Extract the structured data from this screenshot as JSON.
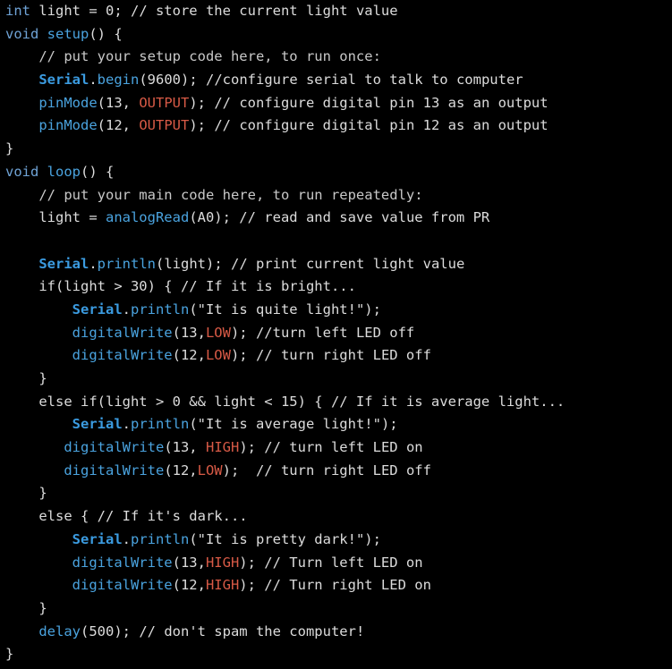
{
  "colors": {
    "background": "#000000",
    "plain": "#dcdcdc",
    "type_keyword": "#6fa3d6",
    "function": "#4aa3df",
    "serial_object": "#3b9be0",
    "constant": "#d85a46"
  },
  "code": {
    "lines": [
      [
        {
          "t": "int",
          "k": "type"
        },
        {
          "t": " light = 0; // store the current light value",
          "k": "plain"
        }
      ],
      [
        {
          "t": "void",
          "k": "type"
        },
        {
          "t": " ",
          "k": "plain"
        },
        {
          "t": "setup",
          "k": "func"
        },
        {
          "t": "() {",
          "k": "plain"
        }
      ],
      [
        {
          "t": "    // put your setup code here, to run once:",
          "k": "comment"
        }
      ],
      [
        {
          "t": "    ",
          "k": "plain"
        },
        {
          "t": "Serial",
          "k": "serial"
        },
        {
          "t": ".",
          "k": "plain"
        },
        {
          "t": "begin",
          "k": "func"
        },
        {
          "t": "(9600); //configure serial to talk to computer",
          "k": "plain"
        }
      ],
      [
        {
          "t": "    ",
          "k": "plain"
        },
        {
          "t": "pinMode",
          "k": "func"
        },
        {
          "t": "(13, ",
          "k": "plain"
        },
        {
          "t": "OUTPUT",
          "k": "const"
        },
        {
          "t": "); // configure digital pin 13 as an output",
          "k": "plain"
        }
      ],
      [
        {
          "t": "    ",
          "k": "plain"
        },
        {
          "t": "pinMode",
          "k": "func"
        },
        {
          "t": "(12, ",
          "k": "plain"
        },
        {
          "t": "OUTPUT",
          "k": "const"
        },
        {
          "t": "); // configure digital pin 12 as an output",
          "k": "plain"
        }
      ],
      [
        {
          "t": "}",
          "k": "plain"
        }
      ],
      [
        {
          "t": "void",
          "k": "type"
        },
        {
          "t": " ",
          "k": "plain"
        },
        {
          "t": "loop",
          "k": "func"
        },
        {
          "t": "() {",
          "k": "plain"
        }
      ],
      [
        {
          "t": "    // put your main code here, to run repeatedly:",
          "k": "comment"
        }
      ],
      [
        {
          "t": "    light = ",
          "k": "plain"
        },
        {
          "t": "analogRead",
          "k": "func"
        },
        {
          "t": "(A0); // read and save value from PR",
          "k": "plain"
        }
      ],
      [
        {
          "t": "",
          "k": "plain"
        }
      ],
      [
        {
          "t": "    ",
          "k": "plain"
        },
        {
          "t": "Serial",
          "k": "serial"
        },
        {
          "t": ".",
          "k": "plain"
        },
        {
          "t": "println",
          "k": "func"
        },
        {
          "t": "(light); // print current light value",
          "k": "plain"
        }
      ],
      [
        {
          "t": "    if(light > 30) { // If it is bright...",
          "k": "plain"
        }
      ],
      [
        {
          "t": "        ",
          "k": "plain"
        },
        {
          "t": "Serial",
          "k": "serial"
        },
        {
          "t": ".",
          "k": "plain"
        },
        {
          "t": "println",
          "k": "func"
        },
        {
          "t": "(\"It is quite light!\");",
          "k": "plain"
        }
      ],
      [
        {
          "t": "        ",
          "k": "plain"
        },
        {
          "t": "digitalWrite",
          "k": "func"
        },
        {
          "t": "(13,",
          "k": "plain"
        },
        {
          "t": "LOW",
          "k": "const"
        },
        {
          "t": "); //turn left LED off",
          "k": "plain"
        }
      ],
      [
        {
          "t": "        ",
          "k": "plain"
        },
        {
          "t": "digitalWrite",
          "k": "func"
        },
        {
          "t": "(12,",
          "k": "plain"
        },
        {
          "t": "LOW",
          "k": "const"
        },
        {
          "t": "); // turn right LED off",
          "k": "plain"
        }
      ],
      [
        {
          "t": "    }",
          "k": "plain"
        }
      ],
      [
        {
          "t": "    else if(light > 0 && light < 15) { // If it is average light...",
          "k": "plain"
        }
      ],
      [
        {
          "t": "        ",
          "k": "plain"
        },
        {
          "t": "Serial",
          "k": "serial"
        },
        {
          "t": ".",
          "k": "plain"
        },
        {
          "t": "println",
          "k": "func"
        },
        {
          "t": "(\"It is average light!\");",
          "k": "plain"
        }
      ],
      [
        {
          "t": "       ",
          "k": "plain"
        },
        {
          "t": "digitalWrite",
          "k": "func"
        },
        {
          "t": "(13, ",
          "k": "plain"
        },
        {
          "t": "HIGH",
          "k": "const"
        },
        {
          "t": "); // turn left LED on",
          "k": "plain"
        }
      ],
      [
        {
          "t": "       ",
          "k": "plain"
        },
        {
          "t": "digitalWrite",
          "k": "func"
        },
        {
          "t": "(12,",
          "k": "plain"
        },
        {
          "t": "LOW",
          "k": "const"
        },
        {
          "t": ");  // turn right LED off",
          "k": "plain"
        }
      ],
      [
        {
          "t": "    }",
          "k": "plain"
        }
      ],
      [
        {
          "t": "    else { // If it's dark...",
          "k": "plain"
        }
      ],
      [
        {
          "t": "        ",
          "k": "plain"
        },
        {
          "t": "Serial",
          "k": "serial"
        },
        {
          "t": ".",
          "k": "plain"
        },
        {
          "t": "println",
          "k": "func"
        },
        {
          "t": "(\"It is pretty dark!\");",
          "k": "plain"
        }
      ],
      [
        {
          "t": "        ",
          "k": "plain"
        },
        {
          "t": "digitalWrite",
          "k": "func"
        },
        {
          "t": "(13,",
          "k": "plain"
        },
        {
          "t": "HIGH",
          "k": "const"
        },
        {
          "t": "); // Turn left LED on",
          "k": "plain"
        }
      ],
      [
        {
          "t": "        ",
          "k": "plain"
        },
        {
          "t": "digitalWrite",
          "k": "func"
        },
        {
          "t": "(12,",
          "k": "plain"
        },
        {
          "t": "HIGH",
          "k": "const"
        },
        {
          "t": "); // Turn right LED on",
          "k": "plain"
        }
      ],
      [
        {
          "t": "    }",
          "k": "plain"
        }
      ],
      [
        {
          "t": "    ",
          "k": "plain"
        },
        {
          "t": "delay",
          "k": "func"
        },
        {
          "t": "(500); // don't spam the computer!",
          "k": "plain"
        }
      ],
      [
        {
          "t": "}",
          "k": "plain"
        }
      ]
    ]
  }
}
